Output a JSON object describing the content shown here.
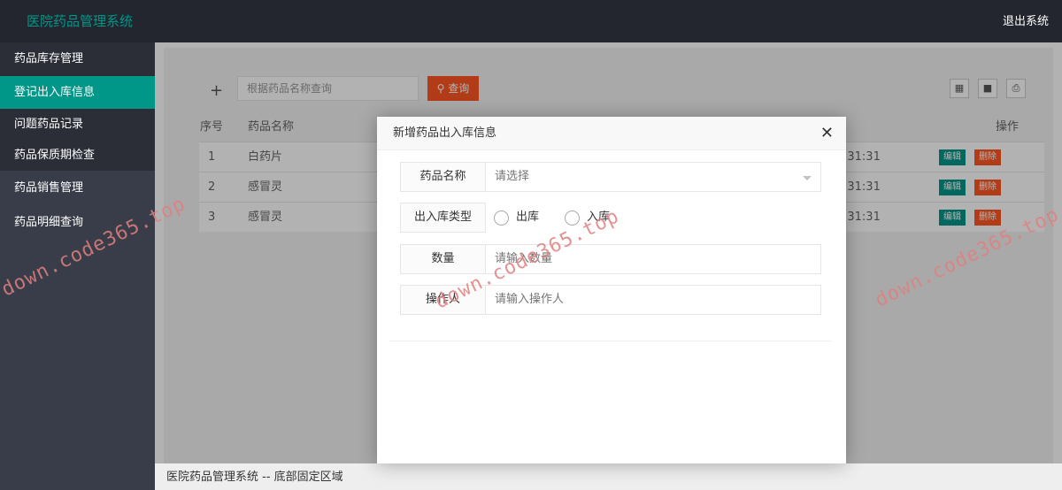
{
  "header": {
    "title": "医院药品管理系统",
    "logout": "退出系统"
  },
  "sidebar": {
    "items": [
      {
        "label": "药品库存管理"
      },
      {
        "label": "登记出入库信息"
      },
      {
        "label": "问题药品记录"
      },
      {
        "label": "药品保质期检查"
      },
      {
        "label": "药品销售管理"
      },
      {
        "label": "药品明细查询"
      }
    ]
  },
  "toolbar": {
    "add_icon": "plus-icon",
    "search_placeholder": "根据药品名称查询",
    "search_label": "查询",
    "tools": [
      "grid-icon",
      "export-icon",
      "print-icon"
    ]
  },
  "table": {
    "headers": {
      "index": "序号",
      "name": "药品名称",
      "actions": "操作"
    },
    "rows": [
      {
        "index": "1",
        "name": "白药片",
        "time": ":31:31",
        "edit": "编辑",
        "delete": "删除"
      },
      {
        "index": "2",
        "name": "感冒灵",
        "time": ":31:31",
        "edit": "编辑",
        "delete": "删除"
      },
      {
        "index": "3",
        "name": "感冒灵",
        "time": ":31:31",
        "edit": "编辑",
        "delete": "删除"
      }
    ]
  },
  "modal": {
    "title": "新增药品出入库信息",
    "close_icon": "close-icon",
    "fields": {
      "drug_name": {
        "label": "药品名称",
        "placeholder": "请选择"
      },
      "type": {
        "label": "出入库类型",
        "options": [
          "出库",
          "入库"
        ]
      },
      "quantity": {
        "label": "数量",
        "placeholder": "请输入数量"
      },
      "operator": {
        "label": "操作人",
        "placeholder": "请输入操作人"
      }
    }
  },
  "footer": {
    "text": "医院药品管理系统 -- 底部固定区域"
  },
  "watermark": "down.code365.top",
  "colors": {
    "accent": "#009688",
    "danger": "#ff5722",
    "header_bg": "#23262e",
    "sidebar_bg": "#393d49"
  }
}
